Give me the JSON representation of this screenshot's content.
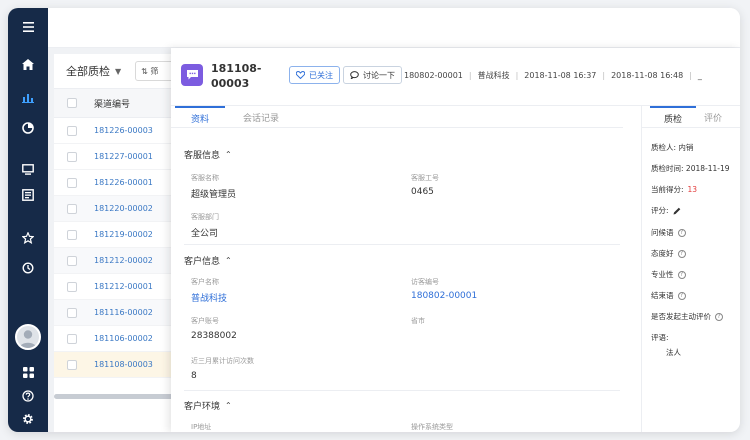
{
  "list": {
    "filter_label": "全部质检",
    "filter_button": "⇅ 筛",
    "column_header": "渠道编号",
    "rows": [
      "181226-00003",
      "181227-00001",
      "181226-00001",
      "181220-00002",
      "181219-00002",
      "181212-00002",
      "181212-00001",
      "181116-00002",
      "181106-00002",
      "181108-00003"
    ]
  },
  "detail": {
    "title": "181108-00003",
    "follow_label": "已关注",
    "discuss_label": "讨论一下",
    "meta": {
      "visitor_id": "180802-00001",
      "company": "普战科技",
      "time_start": "2018-11-08 16:37",
      "time_end": "2018-11-08 16:48"
    },
    "tabs": [
      "资料",
      "会话记录"
    ],
    "sections": {
      "agent": {
        "title": "客服信息",
        "name_label": "客服名称",
        "name_value": "超级管理员",
        "id_label": "客服工号",
        "id_value": "0465",
        "dept_label": "客服部门",
        "dept_value": "全公司"
      },
      "customer": {
        "title": "客户信息",
        "name_label": "客户名称",
        "name_value": "普战科技",
        "visitor_label": "访客编号",
        "visitor_value": "180802-00001",
        "account_label": "客户账号",
        "account_value": "28388002",
        "province_label": "省市",
        "visits_label": "近三月累计访问次数",
        "visits_value": "8"
      },
      "env": {
        "title": "客户环境",
        "ip_label": "IP地址",
        "os_label": "操作系统类型"
      }
    }
  },
  "side": {
    "tabs": [
      "质检",
      "评价"
    ],
    "inspector_label": "质检人:",
    "inspector_value": "内销",
    "time_label": "质检时间:",
    "time_value": "2018-11-19",
    "score_label": "当前得分:",
    "score_value": "13",
    "rating_label": "评分:",
    "criteria": [
      "问候语",
      "态度好",
      "专业性",
      "结束语",
      "是否发起主动评价"
    ],
    "comment_label": "评语:",
    "comment_value": "法人"
  },
  "colors": {
    "nav_bg": "#162a48",
    "accent": "#2f6fd8",
    "link": "#3a78c4",
    "score_red": "#e23b3b",
    "detail_icon": "#7c5ce0"
  }
}
